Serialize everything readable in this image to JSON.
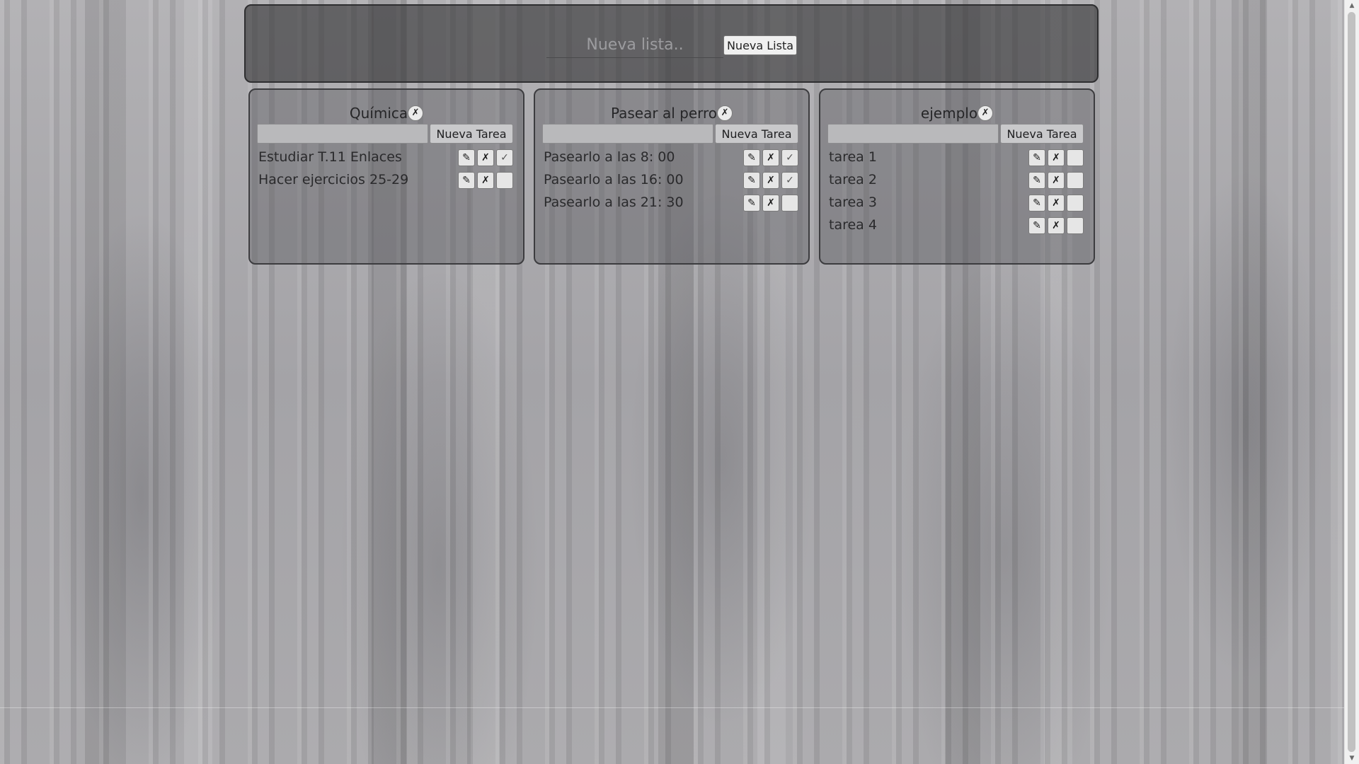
{
  "header": {
    "new_list_placeholder": "Nueva lista..",
    "new_list_button": "Nueva Lista"
  },
  "icons": {
    "edit": "✎",
    "delete": "✗",
    "done": "✓"
  },
  "task_button_label": "Nueva Tarea",
  "lists": [
    {
      "title": "Química",
      "tasks": [
        {
          "text": "Estudiar T.11 Enlaces",
          "done": "✓"
        },
        {
          "text": "Hacer ejercicios 25-29",
          "done": ""
        }
      ]
    },
    {
      "title": "Pasear al perro",
      "tasks": [
        {
          "text": "Pasearlo a las 8: 00",
          "done": "✓"
        },
        {
          "text": "Pasearlo a las 16: 00",
          "done": "✓"
        },
        {
          "text": "Pasearlo a las 21: 30",
          "done": ""
        }
      ]
    },
    {
      "title": "ejemplo",
      "tasks": [
        {
          "text": "tarea 1",
          "done": ""
        },
        {
          "text": "tarea 2",
          "done": ""
        },
        {
          "text": "tarea 3",
          "done": ""
        },
        {
          "text": "tarea 4",
          "done": ""
        }
      ]
    }
  ]
}
